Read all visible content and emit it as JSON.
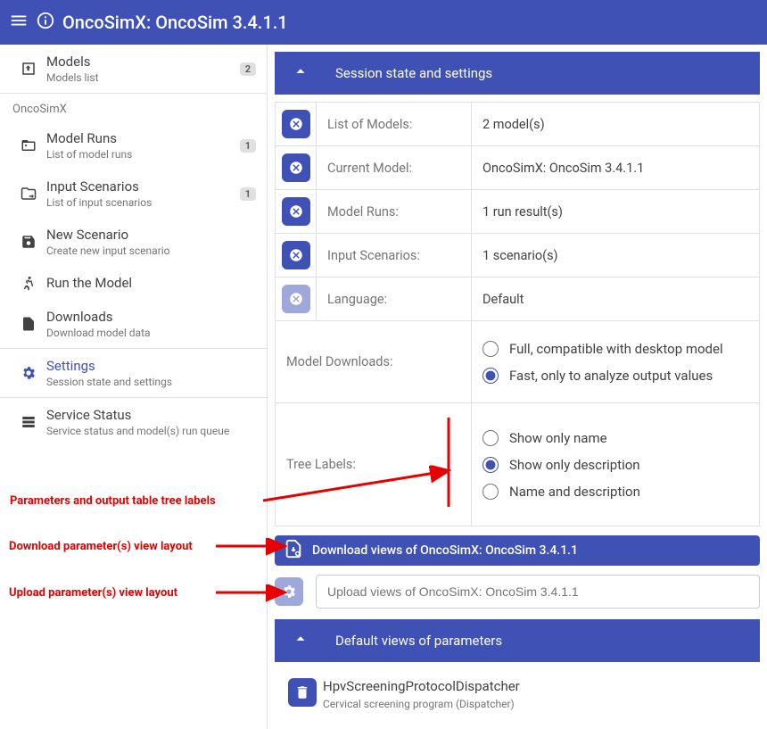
{
  "header": {
    "title": "OncoSimX: OncoSim 3.4.1.1"
  },
  "sidebar": {
    "models_title": "Models",
    "models_sub": "Models list",
    "models_badge": "2",
    "project": "OncoSimX",
    "runs_title": "Model Runs",
    "runs_sub": "List of model runs",
    "runs_badge": "1",
    "inputs_title": "Input Scenarios",
    "inputs_sub": "List of input scenarios",
    "inputs_badge": "1",
    "new_title": "New Scenario",
    "new_sub": "Create new input scenario",
    "run_title": "Run the Model",
    "dl_title": "Downloads",
    "dl_sub": "Download model data",
    "settings_title": "Settings",
    "settings_sub": "Session state and settings",
    "status_title": "Service Status",
    "status_sub": "Service status and model(s) run queue"
  },
  "panel": {
    "title": "Session state and settings"
  },
  "rows": {
    "r1_l": "List of Models:",
    "r1_v": "2 model(s)",
    "r2_l": "Current Model:",
    "r2_v": "OncoSimX: OncoSim 3.4.1.1",
    "r3_l": "Model Runs:",
    "r3_v": "1 run result(s)",
    "r4_l": "Input Scenarios:",
    "r4_v": "1 scenario(s)",
    "r5_l": "Language:",
    "r5_v": "Default",
    "r6_l": "Model Downloads:",
    "r6_o1": "Full, compatible with desktop model",
    "r6_o2": "Fast, only to analyze output values",
    "r7_l": "Tree Labels:",
    "r7_o1": "Show only name",
    "r7_o2": "Show only description",
    "r7_o3": "Name and description"
  },
  "dl": {
    "label": "Download views of OncoSimX: OncoSim 3.4.1.1"
  },
  "up": {
    "placeholder": "Upload views of OncoSimX: OncoSim 3.4.1.1"
  },
  "panel2": {
    "title": "Default views of parameters"
  },
  "pv": {
    "name": "HpvScreeningProtocolDispatcher",
    "sub": "Cervical screening program (Dispatcher)"
  },
  "annot": {
    "a1": "Parameters and output table tree labels",
    "a2": "Download parameter(s) view layout",
    "a3": "Upload parameter(s) view layout"
  }
}
